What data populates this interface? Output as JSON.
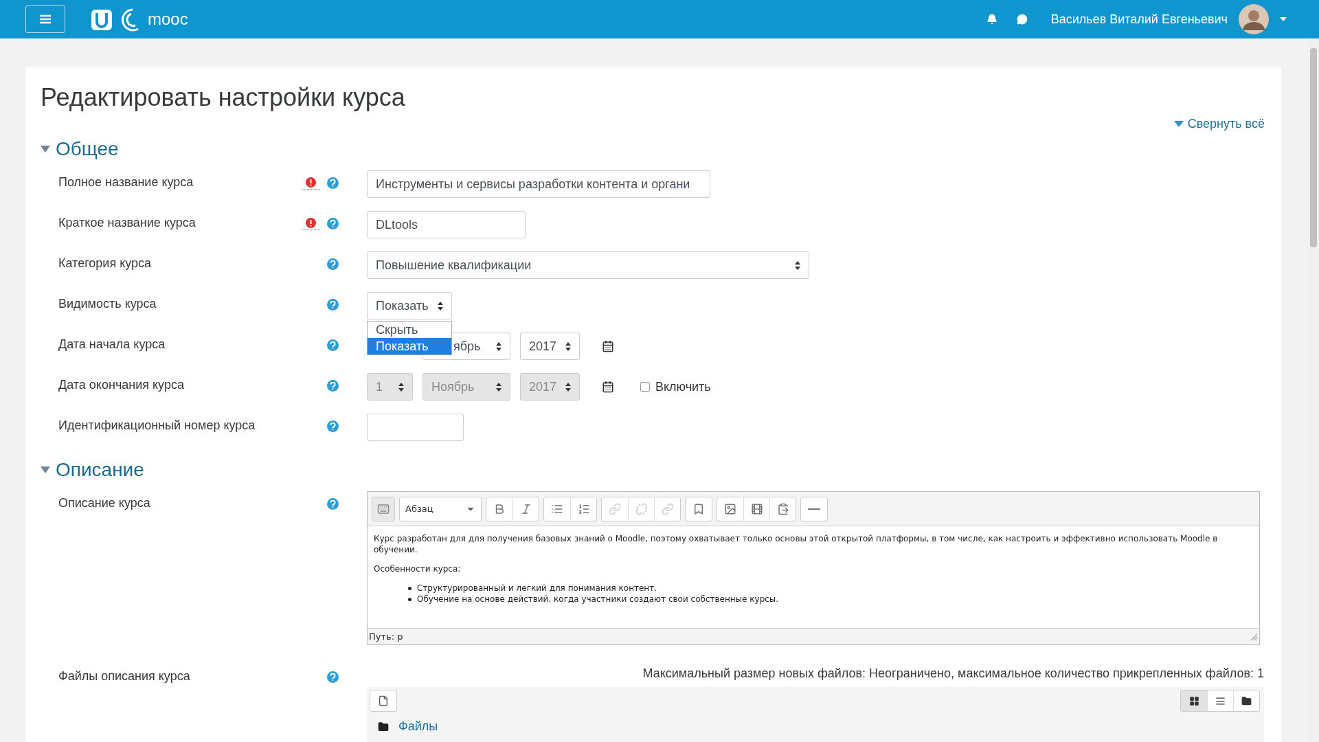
{
  "header": {
    "logo_text": "mooc",
    "user_name": "Васильев Виталий Евгеньевич"
  },
  "page": {
    "title": "Редактировать настройки курса",
    "collapse_all": "Свернуть всё"
  },
  "sections": [
    {
      "title": "Общее",
      "expanded": true,
      "fields": [
        {
          "kind": "text",
          "label": "Полное название курса",
          "required": true,
          "value": "Инструменты и сервисы разработки контента и органи"
        },
        {
          "kind": "text",
          "label": "Краткое название курса",
          "required": true,
          "value": "DLtools"
        },
        {
          "kind": "select",
          "label": "Категория курса",
          "value": "Повышение квалификации"
        },
        {
          "kind": "open_select",
          "label": "Видимость курса",
          "value": "Показать",
          "options": [
            {
              "label": "Скрыть",
              "selected": false
            },
            {
              "label": "Показать",
              "selected": true
            }
          ]
        },
        {
          "kind": "date",
          "label": "Дата начала курса",
          "parts": [
            {
              "value": "ябрь"
            },
            {
              "value": "2017"
            }
          ],
          "disabled": false
        },
        {
          "kind": "date",
          "label": "Дата окончания курса",
          "parts": [
            {
              "value": "1"
            },
            {
              "value": "Ноябрь"
            },
            {
              "value": "2017"
            }
          ],
          "disabled": true,
          "enable": {
            "label": "Включить",
            "checked": false
          }
        },
        {
          "kind": "text",
          "label": "Идентификационный номер курса"
        }
      ]
    },
    {
      "title": "Описание",
      "expanded": true,
      "fields": [
        {
          "kind": "editor",
          "label": "Описание курса",
          "format": "Абзац",
          "paragraphs": [
            "Курс разработан для для получения базовых знаний о Moodle, поэтому охватывает только основы этой открытой платформы, в том числе, как настроить и эффективно использовать Moodle в обучении.",
            "Особенности курса:"
          ],
          "bullets": [
            "Структурированный и легкий для понимания контент.",
            "Обучение на основе действий, когда участники создают свои собственные курсы."
          ],
          "path": "Путь: p"
        },
        {
          "kind": "files",
          "label": "Файлы описания курса",
          "limits": "Максимальный размер новых файлов: Неограничено, максимальное количество прикрепленных файлов: 1",
          "folder": "Файлы"
        }
      ]
    }
  ]
}
